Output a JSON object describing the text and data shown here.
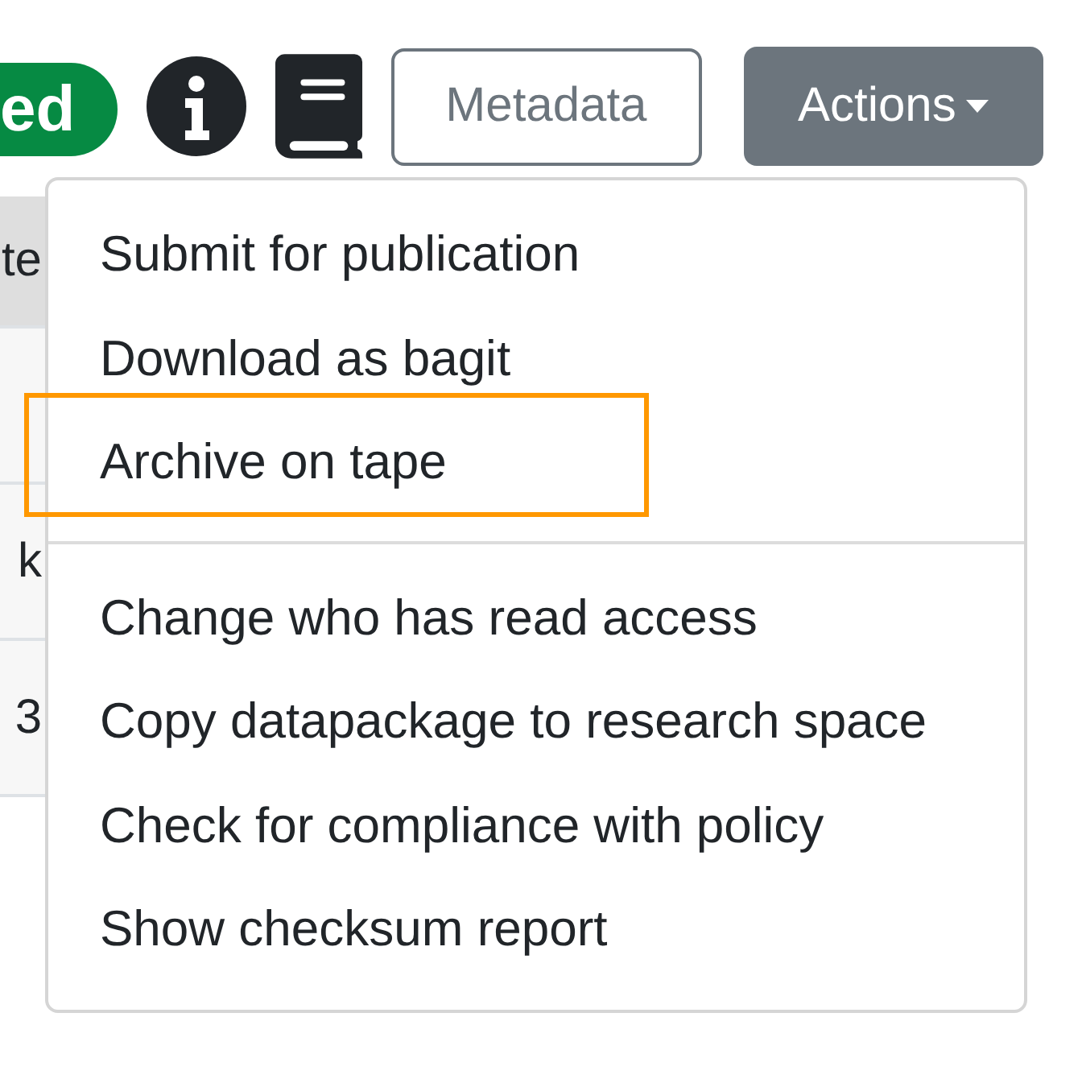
{
  "status_badge": {
    "text": "ed"
  },
  "toolbar": {
    "metadata_button": "Metadata",
    "actions_button": "Actions"
  },
  "table": {
    "cells": [
      {
        "text": "te",
        "kind": "header"
      },
      {
        "kind": "body"
      },
      {
        "text": "k",
        "kind": "body"
      },
      {
        "text": "3",
        "kind": "body"
      }
    ]
  },
  "menu": {
    "sections": [
      {
        "items": [
          {
            "label": "Submit for publication",
            "highlighted": false
          },
          {
            "label": "Download as bagit",
            "highlighted": false
          },
          {
            "label": "Archive on tape",
            "highlighted": true
          }
        ]
      },
      {
        "items": [
          {
            "label": "Change who has read access",
            "highlighted": false
          },
          {
            "label": "Copy datapackage to research space",
            "highlighted": false
          },
          {
            "label": "Check for compliance with policy",
            "highlighted": false
          },
          {
            "label": "Show checksum report",
            "highlighted": false
          }
        ]
      }
    ]
  }
}
